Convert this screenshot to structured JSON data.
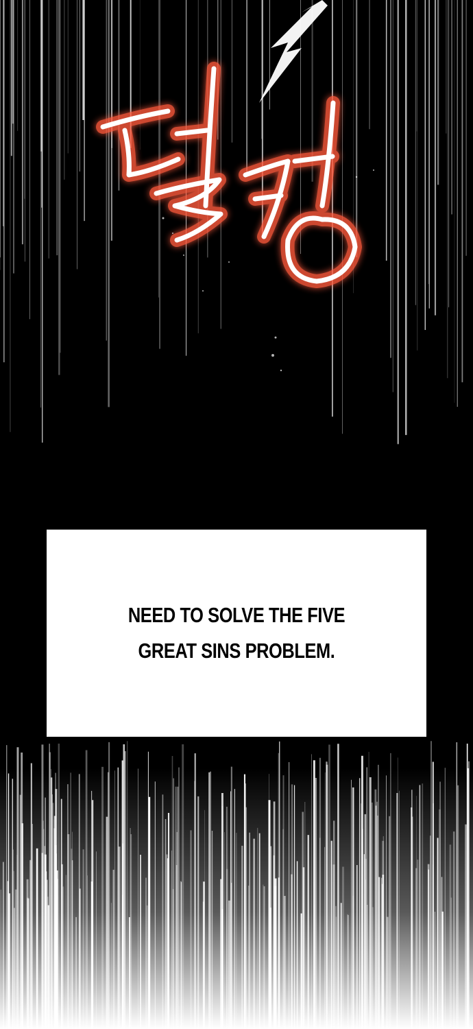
{
  "panel": {
    "sound_effect": "덜컹",
    "caption": "NEED TO SOLVE THE FIVE GREAT SINS PROBLEM.",
    "colors": {
      "background": "#000000",
      "caption_box": "#ffffff",
      "caption_text": "#000000",
      "sfx_glow": "#ff5a3c",
      "sfx_core": "#ffffff",
      "speed_lines": "#ffffff"
    }
  }
}
